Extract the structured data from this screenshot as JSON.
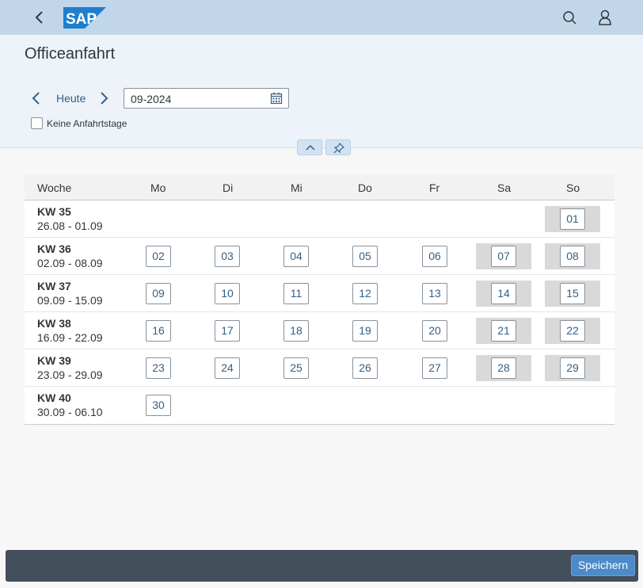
{
  "shell": {
    "logo_text": "SAP",
    "colors": {
      "shellbar": "#c2d6ea",
      "logo": "#1e7fcf",
      "header": "#edf3f9",
      "link": "#346187",
      "footer": "#434f5a",
      "save": "#4b8bc9"
    }
  },
  "page": {
    "title": "Officeanfahrt"
  },
  "filter": {
    "today_label": "Heute",
    "date_value": "09-2024",
    "checkbox_label": "Keine Anfahrtstage",
    "checkbox_checked": false
  },
  "table": {
    "headers": [
      "Woche",
      "Mo",
      "Di",
      "Mi",
      "Do",
      "Fr",
      "Sa",
      "So"
    ],
    "rows": [
      {
        "kw": "KW 35",
        "range": "26.08 - 01.09",
        "days": [
          "",
          "",
          "",
          "",
          "",
          "",
          "01"
        ]
      },
      {
        "kw": "KW 36",
        "range": "02.09 - 08.09",
        "days": [
          "02",
          "03",
          "04",
          "05",
          "06",
          "07",
          "08"
        ]
      },
      {
        "kw": "KW 37",
        "range": "09.09 - 15.09",
        "days": [
          "09",
          "10",
          "11",
          "12",
          "13",
          "14",
          "15"
        ]
      },
      {
        "kw": "KW 38",
        "range": "16.09 - 22.09",
        "days": [
          "16",
          "17",
          "18",
          "19",
          "20",
          "21",
          "22"
        ]
      },
      {
        "kw": "KW 39",
        "range": "23.09 - 29.09",
        "days": [
          "23",
          "24",
          "25",
          "26",
          "27",
          "28",
          "29"
        ]
      },
      {
        "kw": "KW 40",
        "range": "30.09 - 06.10",
        "days": [
          "30",
          "",
          "",
          "",
          "",
          "",
          ""
        ]
      }
    ]
  },
  "footer": {
    "save_label": "Speichern"
  }
}
